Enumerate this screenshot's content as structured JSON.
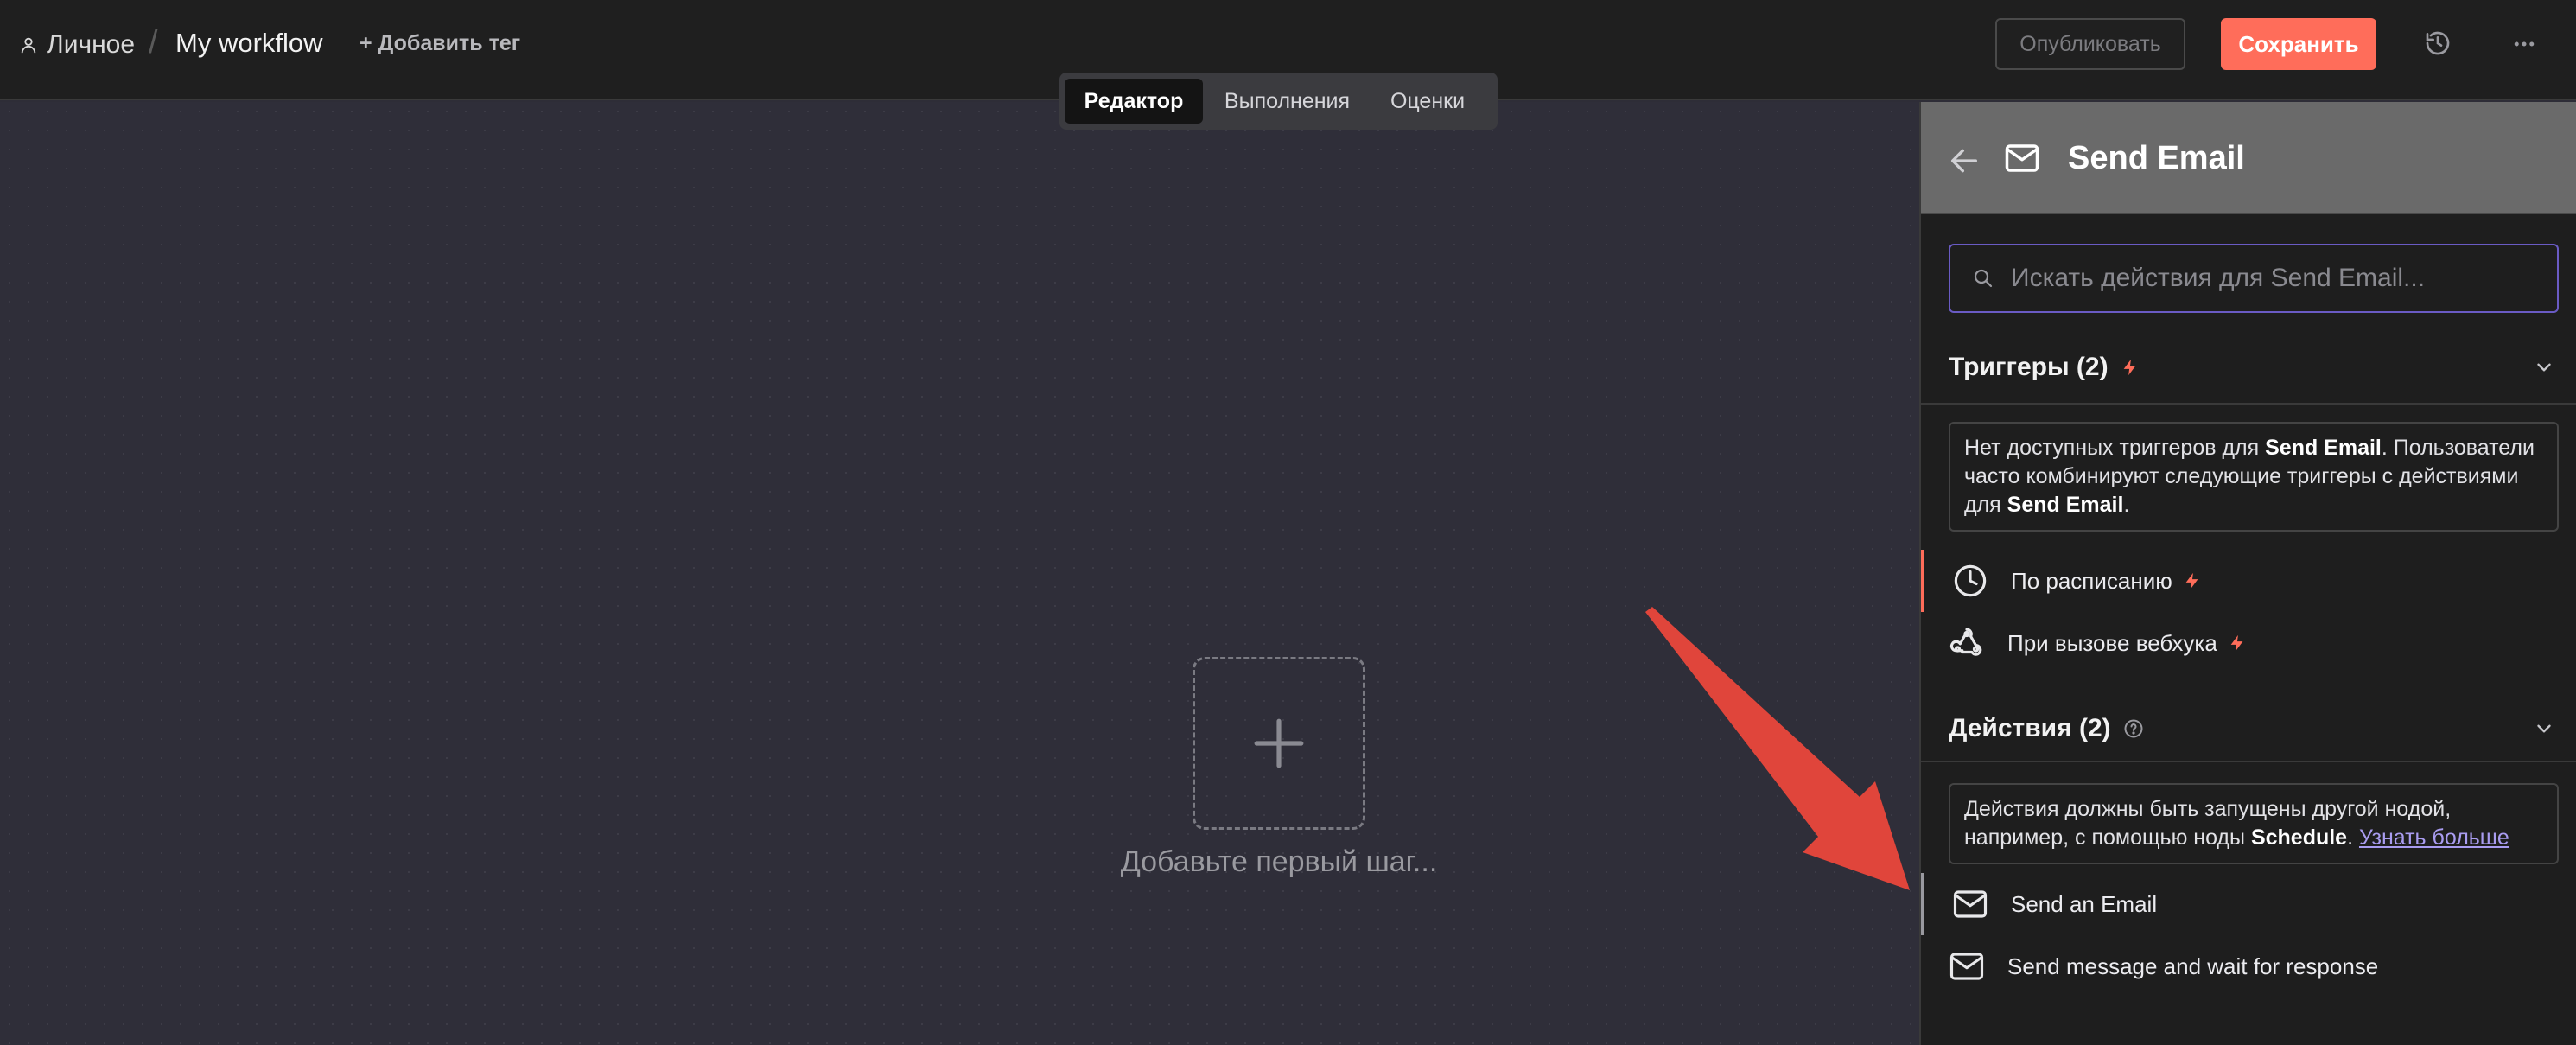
{
  "header": {
    "breadcrumb_personal": "Личное",
    "breadcrumb_separator": "/",
    "workflow_name": "My workflow",
    "add_tag": "+ Добавить тег",
    "publish_label": "Опубликовать",
    "save_label": "Сохранить"
  },
  "tabs": [
    {
      "label": "Редактор",
      "active": true
    },
    {
      "label": "Выполнения",
      "active": false
    },
    {
      "label": "Оценки",
      "active": false
    }
  ],
  "canvas": {
    "add_first_step": "Добавьте первый шаг..."
  },
  "panel": {
    "title": "Send Email",
    "search_placeholder": "Искать действия для Send Email...",
    "triggers": {
      "title": "Триггеры (2)",
      "info_text_1": "Нет доступных триггеров для ",
      "info_bold_1": "Send Email",
      "info_text_2": ". Пользователи часто комбинируют следующие триггеры с действиями для ",
      "info_bold_2": "Send Email",
      "info_text_3": ".",
      "items": [
        {
          "label": "По расписанию",
          "icon": "clock-icon"
        },
        {
          "label": "При вызове вебхука",
          "icon": "webhook-icon"
        }
      ]
    },
    "actions": {
      "title": "Действия (2)",
      "info_text_1": "Действия должны быть запущены другой нодой, например, с помощью ноды ",
      "info_bold_1": "Schedule",
      "info_text_2": ". ",
      "info_link": "Узнать больше",
      "items": [
        {
          "label": "Send an Email",
          "icon": "mail-icon"
        },
        {
          "label": "Send message and wait for response",
          "icon": "mail-icon"
        }
      ]
    }
  },
  "colors": {
    "accent": "#ff6d5a",
    "focus_border": "#6a5bc4",
    "link": "#a99cf0",
    "annotation_arrow": "#e0453b"
  }
}
